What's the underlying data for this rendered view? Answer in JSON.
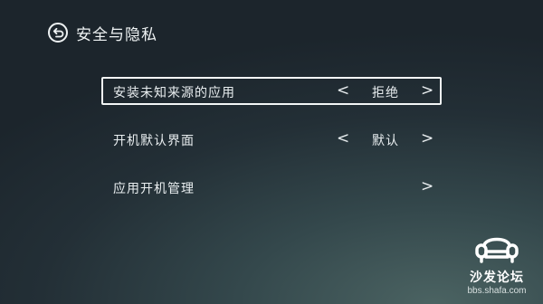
{
  "header": {
    "title": "安全与隐私",
    "back_icon": "back-circle-icon"
  },
  "settings": [
    {
      "label": "安装未知来源的应用",
      "value": "拒绝",
      "has_left_arrow": true,
      "has_right_arrow": true,
      "focused": true
    },
    {
      "label": "开机默认界面",
      "value": "默认",
      "has_left_arrow": true,
      "has_right_arrow": true,
      "focused": false
    },
    {
      "label": "应用开机管理",
      "value": "",
      "has_left_arrow": false,
      "has_right_arrow": true,
      "focused": false
    }
  ],
  "arrows": {
    "left": "<",
    "right": ">"
  },
  "watermark": {
    "text": "沙发论坛",
    "url": "bbs.shafa.com",
    "icon": "sofa-logo-icon"
  },
  "colors": {
    "text": "#e9eef0",
    "focus_border": "#f3f6f6",
    "background_dark": "#1c252c",
    "background_glow": "#4b6362"
  }
}
